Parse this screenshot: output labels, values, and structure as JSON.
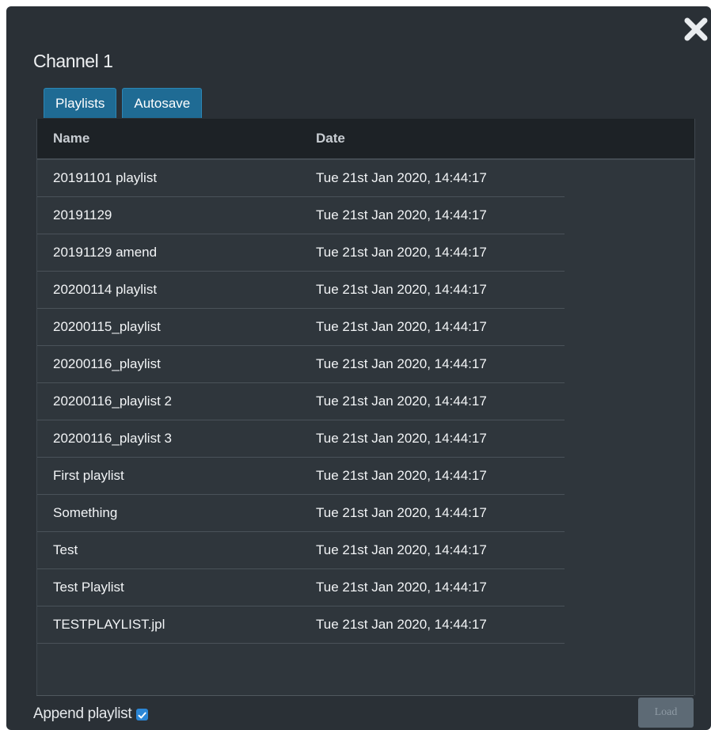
{
  "dialog": {
    "title": "Channel 1",
    "close_icon": "close-icon"
  },
  "tabs": [
    {
      "label": "Playlists"
    },
    {
      "label": "Autosave"
    }
  ],
  "table": {
    "columns": [
      "Name",
      "Date"
    ],
    "rows": [
      {
        "name": "20191101 playlist",
        "date": "Tue 21st Jan 2020, 14:44:17"
      },
      {
        "name": "20191129",
        "date": "Tue 21st Jan 2020, 14:44:17"
      },
      {
        "name": "20191129 amend",
        "date": "Tue 21st Jan 2020, 14:44:17"
      },
      {
        "name": "20200114 playlist",
        "date": "Tue 21st Jan 2020, 14:44:17"
      },
      {
        "name": "20200115_playlist",
        "date": "Tue 21st Jan 2020, 14:44:17"
      },
      {
        "name": "20200116_playlist",
        "date": "Tue 21st Jan 2020, 14:44:17"
      },
      {
        "name": "20200116_playlist 2",
        "date": "Tue 21st Jan 2020, 14:44:17"
      },
      {
        "name": "20200116_playlist 3",
        "date": "Tue 21st Jan 2020, 14:44:17"
      },
      {
        "name": "First playlist",
        "date": "Tue 21st Jan 2020, 14:44:17"
      },
      {
        "name": "Something",
        "date": "Tue 21st Jan 2020, 14:44:17"
      },
      {
        "name": "Test",
        "date": "Tue 21st Jan 2020, 14:44:17"
      },
      {
        "name": "Test Playlist",
        "date": "Tue 21st Jan 2020, 14:44:17"
      },
      {
        "name": "TESTPLAYLIST.jpl",
        "date": "Tue 21st Jan 2020, 14:44:17"
      }
    ]
  },
  "footer": {
    "append_label": "Append playlist",
    "append_checked": true,
    "load_label": "Load"
  },
  "colors": {
    "dialog_bg": "#2a3036",
    "tab_bg": "#1f6b94",
    "checkbox_accent": "#2b86d6"
  }
}
